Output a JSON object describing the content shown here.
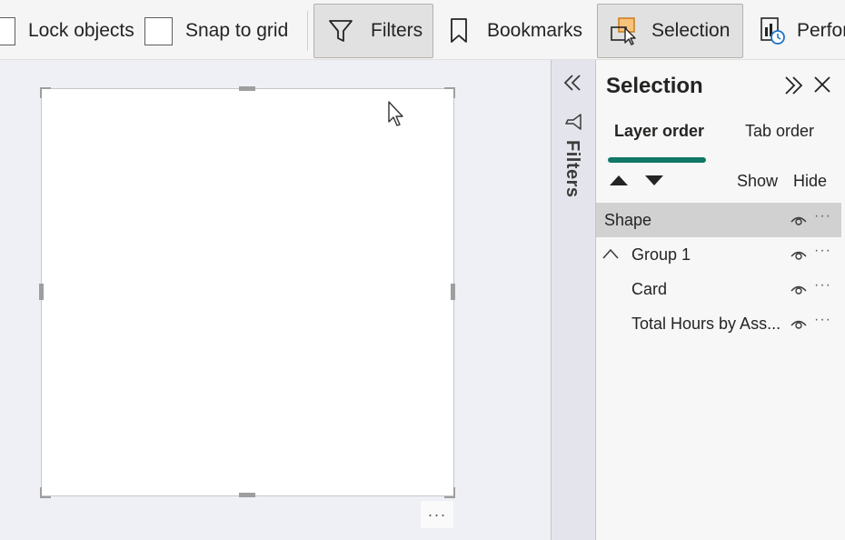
{
  "ribbon": {
    "lock_objects": "Lock objects",
    "snap_to_grid": "Snap to grid",
    "filters": "Filters",
    "bookmarks": "Bookmarks",
    "selection": "Selection",
    "performance": "Perfor"
  },
  "canvas": {
    "visual_more": "···"
  },
  "filters_pane": {
    "label": "Filters"
  },
  "selection_pane": {
    "title": "Selection",
    "tabs": [
      {
        "label": "Layer order",
        "active": true
      },
      {
        "label": "Tab order",
        "active": false
      }
    ],
    "show_label": "Show",
    "hide_label": "Hide",
    "items": [
      {
        "name": "Shape",
        "selected": true
      },
      {
        "name": "Group 1",
        "group": true,
        "expanded": true
      },
      {
        "name": "Card"
      },
      {
        "name": "Total Hours by Ass..."
      }
    ],
    "more": "···"
  },
  "colors": {
    "accent": "#117865",
    "selected_row": "#d1d1d1",
    "canvas_bg": "#eef0f6"
  }
}
